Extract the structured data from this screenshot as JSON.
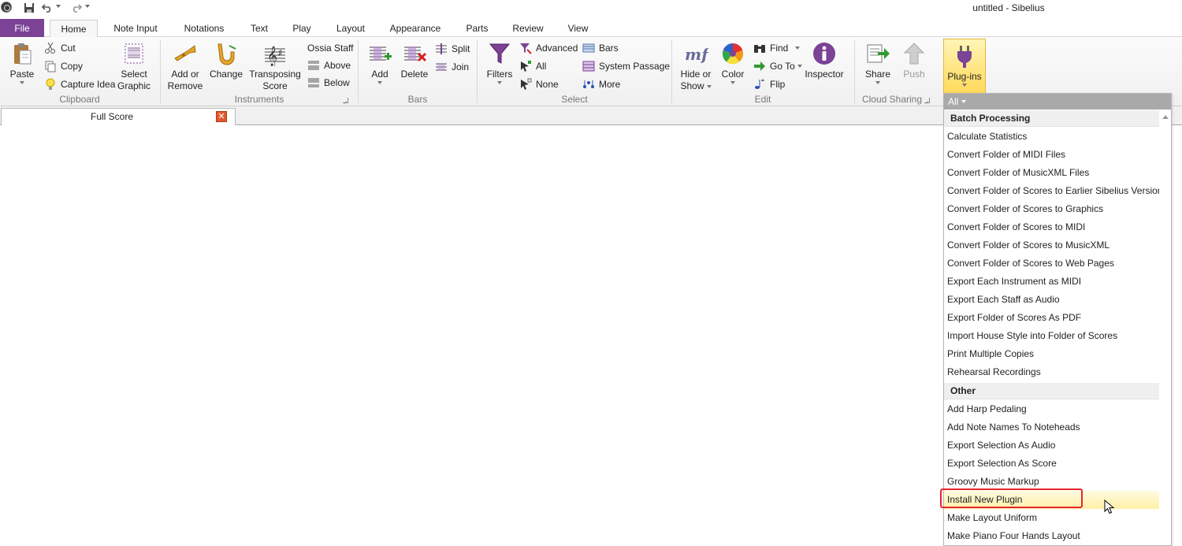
{
  "window": {
    "title": "untitled - Sibelius"
  },
  "quick_access": {
    "save": "save-icon",
    "undo": "undo-icon",
    "redo": "redo-icon"
  },
  "tabs": {
    "file": "File",
    "home": "Home",
    "note_input": "Note Input",
    "notations": "Notations",
    "text": "Text",
    "play": "Play",
    "layout": "Layout",
    "appearance": "Appearance",
    "parts": "Parts",
    "review": "Review",
    "view": "View"
  },
  "ribbon": {
    "clipboard": {
      "label": "Clipboard",
      "paste": "Paste",
      "cut": "Cut",
      "copy": "Copy",
      "capture_idea": "Capture Idea",
      "select_graphic_1": "Select",
      "select_graphic_2": "Graphic"
    },
    "instruments": {
      "label": "Instruments",
      "add_remove_1": "Add or",
      "add_remove_2": "Remove",
      "change": "Change",
      "transposing_1": "Transposing",
      "transposing_2": "Score",
      "ossia": "Ossia Staff",
      "above": "Above",
      "below": "Below"
    },
    "bars": {
      "label": "Bars",
      "add": "Add",
      "delete": "Delete",
      "split": "Split",
      "join": "Join"
    },
    "select": {
      "label": "Select",
      "filters": "Filters",
      "advanced": "Advanced",
      "all": "All",
      "none": "None",
      "bars": "Bars",
      "system_passage": "System Passage",
      "more": "More"
    },
    "edit": {
      "label": "Edit",
      "hide_show_1": "Hide or",
      "hide_show_2": "Show",
      "color": "Color",
      "find": "Find",
      "goto": "Go To",
      "flip": "Flip",
      "inspector": "Inspector"
    },
    "cloud": {
      "label": "Cloud Sharing",
      "share": "Share",
      "push": "Push"
    },
    "plugins": {
      "label": "Plug-ins"
    }
  },
  "document": {
    "tab_label": "Full Score"
  },
  "plugin_menu": {
    "filter": "All",
    "categories": [
      {
        "name": "Batch Processing",
        "items": [
          "Calculate Statistics",
          "Convert Folder of MIDI Files",
          "Convert Folder of MusicXML Files",
          "Convert Folder of Scores to Earlier Sibelius Version",
          "Convert Folder of Scores to Graphics",
          "Convert Folder of Scores to MIDI",
          "Convert Folder of Scores to MusicXML",
          "Convert Folder of Scores to Web Pages",
          "Export Each Instrument as MIDI",
          "Export Each Staff as Audio",
          "Export Folder of Scores As PDF",
          "Import House Style into Folder of Scores",
          "Print Multiple Copies",
          "Rehearsal Recordings"
        ]
      },
      {
        "name": "Other",
        "items": [
          "Add Harp Pedaling",
          "Add Note Names To Noteheads",
          "Export Selection As Audio",
          "Export Selection As Score",
          "Groovy Music Markup",
          "Install New Plugin",
          "Make Layout Uniform",
          "Make Piano Four Hands Layout"
        ]
      }
    ],
    "highlighted_item": "Install New Plugin"
  },
  "colors": {
    "file_tab": "#7b4296",
    "highlight": "#e8262a",
    "plugins_active": "#ffd95a"
  }
}
